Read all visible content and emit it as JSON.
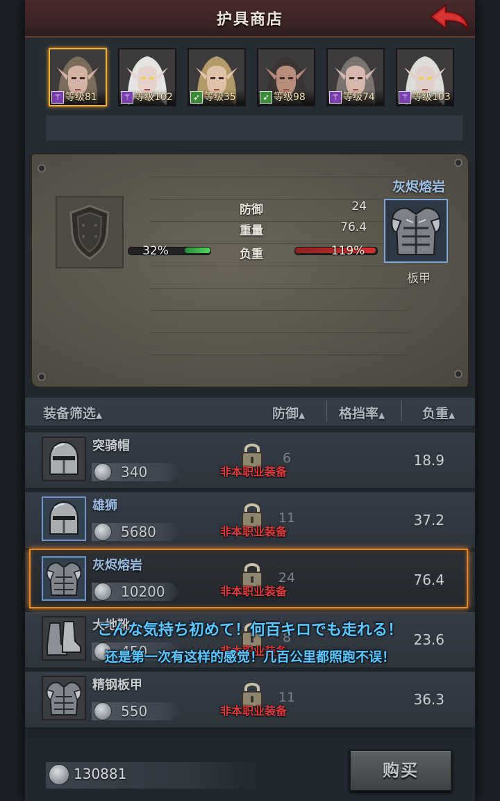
{
  "header": {
    "title": "护具商店",
    "back_icon": "back-arrow-icon"
  },
  "heroes": [
    {
      "level_text": "等级81",
      "class_icon": "staff-icon",
      "class": "mage",
      "selected": true
    },
    {
      "level_text": "等级102",
      "class_icon": "staff-icon",
      "class": "mage",
      "selected": false
    },
    {
      "level_text": "等级35",
      "class_icon": "bow-icon",
      "class": "archer",
      "selected": false
    },
    {
      "level_text": "等级98",
      "class_icon": "bow-icon",
      "class": "archer",
      "selected": false
    },
    {
      "level_text": "等级74",
      "class_icon": "staff-icon",
      "class": "mage",
      "selected": false
    },
    {
      "level_text": "等级103",
      "class_icon": "staff-icon",
      "class": "mage",
      "selected": false
    }
  ],
  "compare": {
    "defense_label": "防御",
    "defense_value": "24",
    "weight_label": "重量",
    "weight_value": "76.4",
    "load_label": "负重",
    "left_percent": "32%",
    "left_fraction": 0.32,
    "right_percent": "119%",
    "right_fraction": 1.0,
    "item_name": "灰烬熔岩",
    "item_type": "板甲",
    "empty_slot_icon": "shield-icon"
  },
  "filter": {
    "label": "装备筛选",
    "col_defense": "防御",
    "col_block": "格挡率",
    "col_load": "负重"
  },
  "items": [
    {
      "name": "突骑帽",
      "price": "340",
      "defense": "6",
      "weight": "18.9",
      "restriction": "非本职业装备",
      "icon": "helmet-icon",
      "rarity": "common"
    },
    {
      "name": "雄狮",
      "price": "5680",
      "defense": "11",
      "weight": "37.2",
      "restriction": "非本职业装备",
      "icon": "helmet-icon",
      "rarity": "rare"
    },
    {
      "name": "灰烬熔岩",
      "price": "10200",
      "defense": "24",
      "weight": "76.4",
      "restriction": "非本职业装备",
      "icon": "plate-armor-icon",
      "rarity": "rare",
      "selected": true
    },
    {
      "name": "大地靴",
      "price": "450",
      "defense": "8",
      "weight": "23.6",
      "restriction": "非本职业装备",
      "icon": "boots-icon",
      "rarity": "common"
    },
    {
      "name": "精钢板甲",
      "price": "550",
      "defense": "11",
      "weight": "36.3",
      "restriction": "非本职业装备",
      "icon": "plate-armor-icon",
      "rarity": "common"
    }
  ],
  "subtitles": {
    "jp": "こんな気持ち初めて！何百キロでも走れる！",
    "cn": "还是第一次有这样的感觉！几百公里都照跑不误！"
  },
  "footer": {
    "currency": "130881",
    "buy_label": "购买"
  },
  "colors": {
    "accent_gold": "#f0b238",
    "restrict_red": "#e03c3c",
    "rare_blue": "#9bbbe1",
    "subtitle_blue": "#5cc8ff"
  }
}
